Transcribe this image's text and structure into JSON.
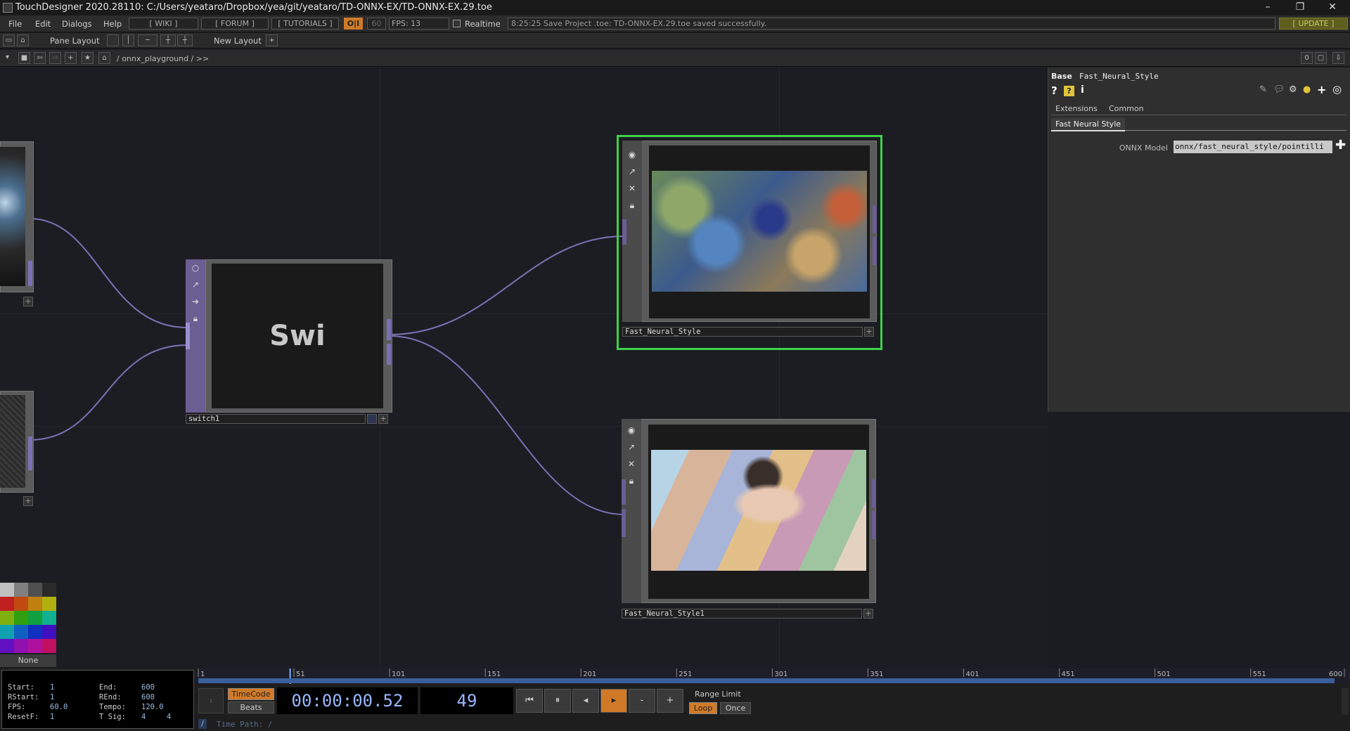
{
  "window": {
    "title": "TouchDesigner 2020.28110: C:/Users/yeataro/Dropbox/yea/git/yeataro/TD-ONNX-EX/TD-ONNX-EX.29.toe",
    "minimize": "–",
    "restore": "❐",
    "close": "✕"
  },
  "menu": {
    "items": [
      "File",
      "Edit",
      "Dialogs",
      "Help"
    ],
    "wiki": "[ WIKI ]",
    "forum": "[ FORUM ]",
    "tutorials": "[ TUTORIALS ]",
    "oi": "O|I",
    "fps_target": "60",
    "fps": "FPS:  13",
    "realtime": "Realtime",
    "status": "8:25:25 Save Project .toe: TD-ONNX-EX.29.toe saved successfully.",
    "update": "[ UPDATE ]"
  },
  "panebar": {
    "pane_layout": "Pane Layout",
    "new_layout": "New Layout",
    "add": "+"
  },
  "pathbar": {
    "path": "/ onnx_playground / >>",
    "zero": "0"
  },
  "nodes": {
    "switch": {
      "label": "switch1",
      "display": "Swi"
    },
    "fns": {
      "label": "Fast_Neural_Style"
    },
    "fns1": {
      "label": "Fast_Neural_Style1"
    }
  },
  "params": {
    "type": "Base",
    "name": "Fast_Neural_Style",
    "tabs": [
      "Extensions",
      "Common"
    ],
    "page": "Fast Neural Style",
    "onnx_label": "ONNX Model",
    "onnx_value": "onnx/fast_neural_style/pointilli"
  },
  "palette": {
    "none": "None"
  },
  "timeline": {
    "ticks": [
      "1",
      "51",
      "101",
      "151",
      "201",
      "251",
      "301",
      "351",
      "401",
      "451",
      "501",
      "551",
      "600"
    ],
    "playhead_frame": 49,
    "range_start": 1,
    "range_end": 600
  },
  "range": {
    "start_l": "Start:",
    "start_v": "1",
    "end_l": "End:",
    "end_v": "600",
    "rstart_l": "RStart:",
    "rstart_v": "1",
    "rend_l": "REnd:",
    "rend_v": "600",
    "fps_l": "FPS:",
    "fps_v": "60.0",
    "tempo_l": "Tempo:",
    "tempo_v": "120.0",
    "resetf_l": "ResetF:",
    "resetf_v": "1",
    "tsig_l": "T Sig:",
    "tsig_a": "4",
    "tsig_b": "4"
  },
  "transport": {
    "timecode": "TimeCode",
    "beats": "Beats",
    "time": "00:00:00.52",
    "frame": "49",
    "range_limit": "Range Limit",
    "loop": "Loop",
    "once": "Once",
    "time_path": "Time Path: /"
  },
  "colors": {
    "accent": "#e0882a",
    "selected_border": "#3ed14a",
    "wire": "#7b70b5"
  }
}
